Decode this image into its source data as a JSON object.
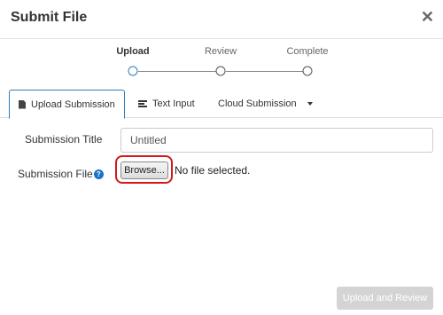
{
  "header": {
    "title": "Submit File",
    "close_glyph": "✕"
  },
  "stepper": {
    "steps": [
      {
        "label": "Upload",
        "active": true
      },
      {
        "label": "Review",
        "active": false
      },
      {
        "label": "Complete",
        "active": false
      }
    ]
  },
  "tabs": [
    {
      "label": "Upload Submission",
      "icon": "file-icon",
      "active": true
    },
    {
      "label": "Text Input",
      "icon": "text-lines-icon",
      "active": false
    },
    {
      "label": "Cloud Submission",
      "icon": "caret-down-icon",
      "active": false
    }
  ],
  "form": {
    "title_label": "Submission Title",
    "title_value": "Untitled",
    "file_label": "Submission File",
    "help_glyph": "?",
    "browse_label": "Browse...",
    "file_status": "No file selected."
  },
  "footer": {
    "submit_label": "Upload and Review"
  },
  "colors": {
    "accent": "#337ab7",
    "highlight": "#d11a1a",
    "disabled": "#d4d4d4"
  }
}
